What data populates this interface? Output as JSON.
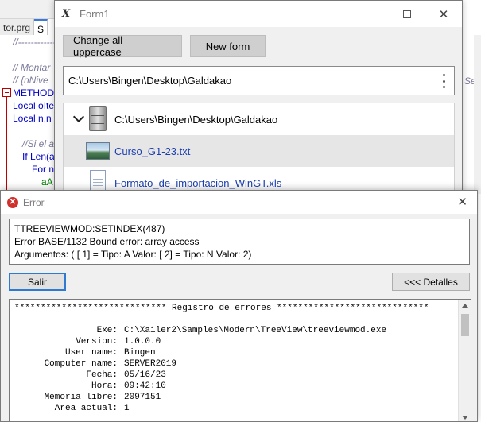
{
  "editor": {
    "tabs": [
      {
        "label": "tor.prg"
      },
      {
        "label": "S"
      }
    ],
    "lines": [
      {
        "text": "//--------------------------",
        "style": "c-comment"
      },
      {
        "text": "// Montar",
        "style": "c-comment"
      },
      {
        "text": "//  {nNive",
        "style": "c-comment"
      },
      {
        "text": "METHOD",
        "style": "c-kw"
      },
      {
        "text": "Local oIte",
        "style": "c-kw"
      },
      {
        "text": "Local n,n",
        "style": "c-kw"
      },
      {
        "text": "//Si el a",
        "style": "c-comment"
      },
      {
        "text": "If Len(a",
        "style": "c-kw"
      },
      {
        "text": "For n",
        "style": "c-kw"
      },
      {
        "text": "aA",
        "style": "c-green"
      }
    ],
    "right_text": "Sele"
  },
  "form1": {
    "title": "Form1",
    "app_icon": "X",
    "buttons": {
      "uppercase": "Change all uppercase",
      "new_form": "New form"
    },
    "path_value": "C:\\Users\\Bingen\\Desktop\\Galdakao",
    "tree": [
      {
        "label": "C:\\Users\\Bingen\\Desktop\\Galdakao",
        "icon": "server-icon"
      },
      {
        "label": "Curso_G1-23.txt",
        "icon": "image-file-icon"
      },
      {
        "label": "Formato_de_importacion_WinGT.xls",
        "icon": "document-icon"
      }
    ]
  },
  "error": {
    "title": "Error",
    "messages": [
      "TTREEVIEWMOD:SETINDEX(487)",
      "Error BASE/1132  Bound error: array access",
      "Argumentos: ( [ 1] = Tipo: A Valor:  [ 2] = Tipo: N Valor: 2)"
    ],
    "salir_label": "Salir",
    "detalles_label": "<<< Detalles",
    "log_header": "***************************** Registro de errores *****************************",
    "log": [
      {
        "key": "Exe:",
        "value": "C:\\Xailer2\\Samples\\Modern\\TreeView\\treeviewmod.exe"
      },
      {
        "key": "Version:",
        "value": "1.0.0.0"
      },
      {
        "key": "User name:",
        "value": "Bingen"
      },
      {
        "key": "Computer name:",
        "value": "SERVER2019"
      },
      {
        "key": "Fecha:",
        "value": "05/16/23"
      },
      {
        "key": "Hora:",
        "value": "09:42:10"
      },
      {
        "key": "Memoria libre:",
        "value": "2097151"
      },
      {
        "key": "Area actual:",
        "value": "1"
      }
    ]
  },
  "colors": {
    "link": "#1c3fb0",
    "error_red": "#d0312d",
    "focus_blue": "#2f7ad1"
  }
}
